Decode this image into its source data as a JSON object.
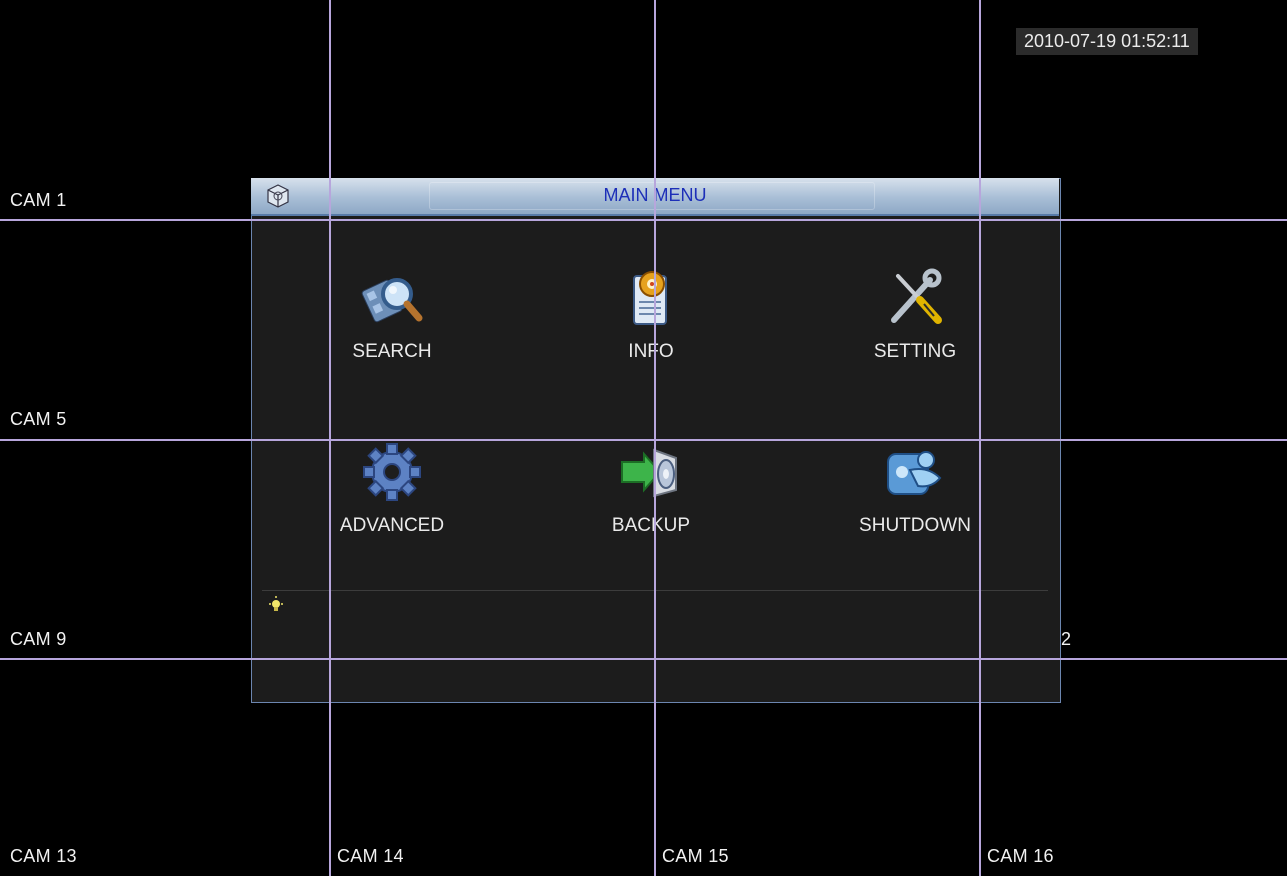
{
  "datetime": "2010-07-19 01:52:11",
  "cameras": {
    "cam1": "CAM 1",
    "cam5": "CAM 5",
    "cam9": "CAM 9",
    "cam12_partial": "2",
    "cam13": "CAM 13",
    "cam14": "CAM 14",
    "cam15": "CAM 15",
    "cam16": "CAM 16"
  },
  "menu": {
    "title": "MAIN MENU",
    "items": [
      {
        "label": "SEARCH",
        "icon": "search-film-icon"
      },
      {
        "label": "INFO",
        "icon": "info-document-gear-icon"
      },
      {
        "label": "SETTING",
        "icon": "wrench-screwdriver-icon"
      },
      {
        "label": "ADVANCED",
        "icon": "gear-icon"
      },
      {
        "label": "BACKUP",
        "icon": "backup-disc-icon"
      },
      {
        "label": "SHUTDOWN",
        "icon": "shutdown-figure-icon"
      }
    ]
  },
  "colors": {
    "grid": "#b7a6dc",
    "title_text": "#1d2fb8",
    "menu_border": "#6c86b0"
  }
}
